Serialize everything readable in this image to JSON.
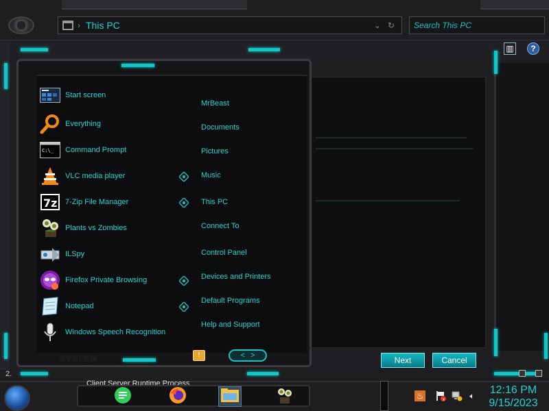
{
  "explorer": {
    "address_path": "This PC",
    "search_placeholder": "Search This PC",
    "status_left": "2.",
    "buttons": {
      "next": "Next",
      "cancel": "Cancel"
    }
  },
  "start_menu": {
    "programs": [
      {
        "label": "Start screen",
        "icon": "start-screen-icon",
        "jump": false
      },
      {
        "label": "Everything",
        "icon": "magnifier-icon",
        "jump": false
      },
      {
        "label": "Command Prompt",
        "icon": "terminal-icon",
        "jump": false
      },
      {
        "label": "VLC media player",
        "icon": "vlc-cone-icon",
        "jump": true
      },
      {
        "label": "7-Zip File Manager",
        "icon": "7zip-icon",
        "jump": true
      },
      {
        "label": "Plants vs Zombies",
        "icon": "plant-icon",
        "jump": false
      },
      {
        "label": "ILSpy",
        "icon": "ilspy-icon",
        "jump": false
      },
      {
        "label": "Firefox Private Browsing",
        "icon": "firefox-private-icon",
        "jump": true
      },
      {
        "label": "Notepad",
        "icon": "notepad-icon",
        "jump": true
      },
      {
        "label": "Windows Speech Recognition",
        "icon": "microphone-icon",
        "jump": false
      }
    ],
    "places": [
      "MrBeast",
      "Documents",
      "Pictures",
      "Music",
      "This PC",
      "Connect To",
      "Control Panel",
      "Devices and Printers",
      "Default Programs",
      "Help and Support"
    ],
    "system_label": "SYSTEM",
    "nav_left": "<",
    "nav_right": ">"
  },
  "taskbar": {
    "window_title": "Client Server Runtime Process",
    "clock": {
      "time": "12:16 PM",
      "date": "9/15/2023"
    }
  },
  "colors": {
    "accent": "#27d2cf",
    "background": "#1b1b1e"
  }
}
